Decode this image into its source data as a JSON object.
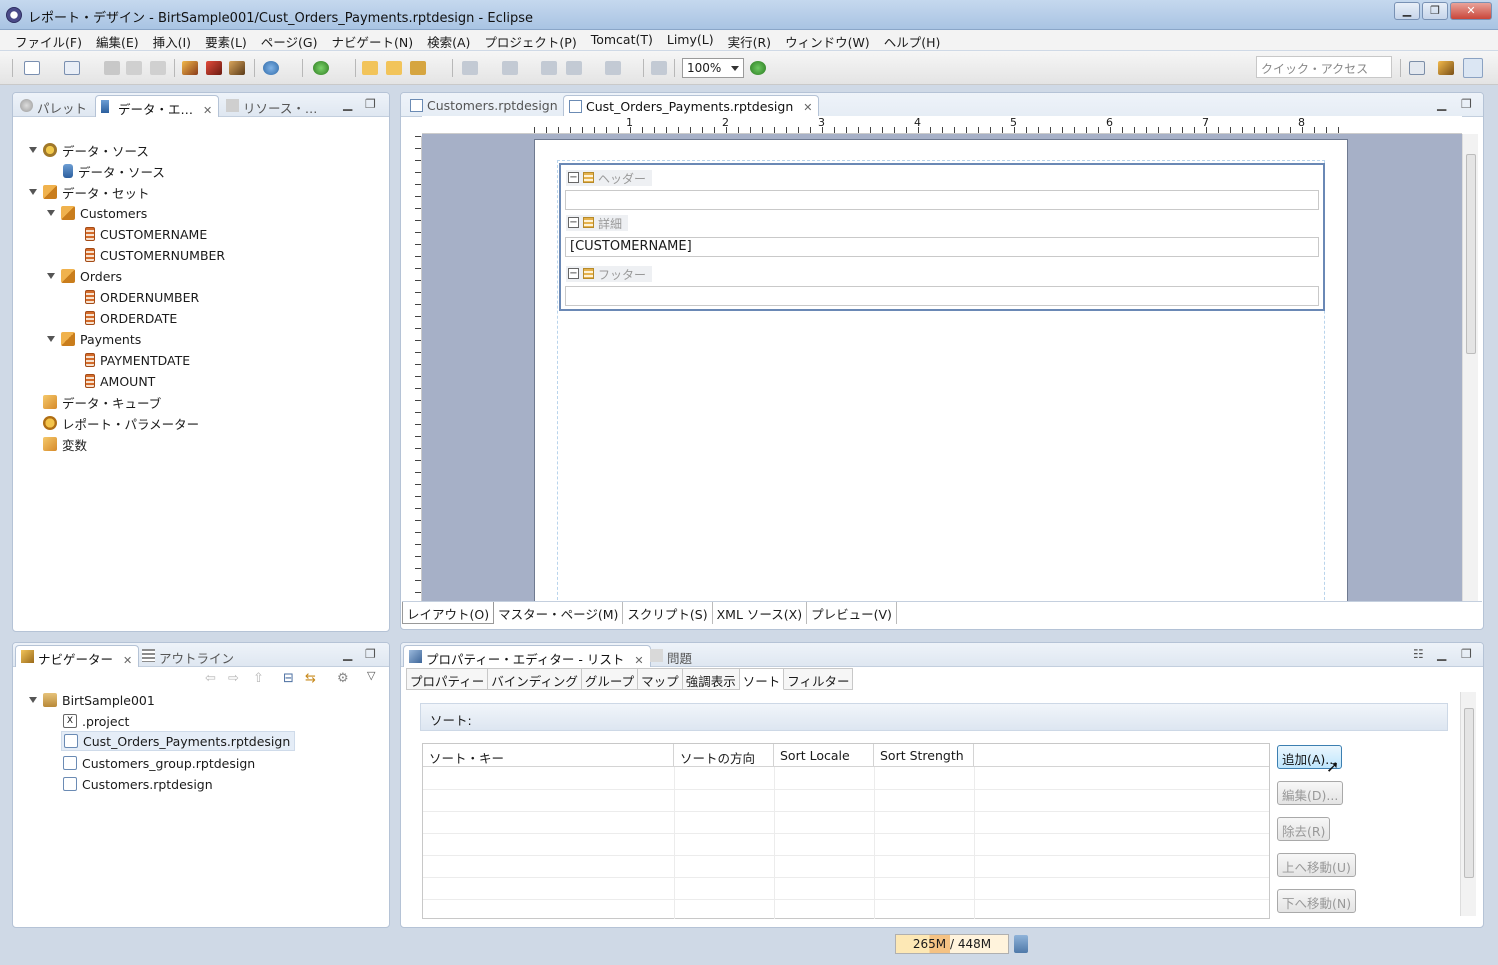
{
  "window": {
    "title": "レポート・デザイン - BirtSample001/Cust_Orders_Payments.rptdesign - Eclipse",
    "min": "▁",
    "max": "❐",
    "close": "✕"
  },
  "menu": [
    "ファイル(F)",
    "編集(E)",
    "挿入(I)",
    "要素(L)",
    "ページ(G)",
    "ナビゲート(N)",
    "検索(A)",
    "プロジェクト(P)",
    "Tomcat(T)",
    "Limy(L)",
    "実行(R)",
    "ウィンドウ(W)",
    "ヘルプ(H)"
  ],
  "toolbar": {
    "zoom": "100%",
    "quick_access_placeholder": "クイック・アクセス"
  },
  "left_top_panel": {
    "tabs": [
      "パレット",
      "データ・エ…",
      "リソース・…"
    ],
    "tree": {
      "data_sources": "データ・ソース",
      "data_source": "データ・ソース",
      "data_sets": "データ・セット",
      "customers": "Customers",
      "customername": "CUSTOMERNAME",
      "customernumber": "CUSTOMERNUMBER",
      "orders": "Orders",
      "ordernumber": "ORDERNUMBER",
      "orderdate": "ORDERDATE",
      "payments": "Payments",
      "paymentdate": "PAYMENTDATE",
      "amount": "AMOUNT",
      "cubes": "データ・キューブ",
      "params": "レポート・パラメーター",
      "variables": "変数"
    }
  },
  "editor": {
    "tabs": [
      "Customers.rptdesign",
      "Cust_Orders_Payments.rptdesign"
    ],
    "ruler_numbers": [
      "1",
      "2",
      "3",
      "4",
      "5",
      "6",
      "7",
      "8"
    ],
    "bands": {
      "header": "ヘッダー",
      "detail": "詳細",
      "footer": "フッター"
    },
    "detail_field": "[CUSTOMERNAME]",
    "bottom_tabs": [
      "レイアウト(O)",
      "マスター・ページ(M)",
      "スクリプト(S)",
      "XML ソース(X)",
      "プレビュー(V)"
    ]
  },
  "navigator": {
    "tabs": [
      "ナビゲーター",
      "アウトライン"
    ],
    "project": "BirtSample001",
    "files": [
      ".project",
      "Cust_Orders_Payments.rptdesign",
      "Customers_group.rptdesign",
      "Customers.rptdesign"
    ]
  },
  "property_editor": {
    "tabs": [
      "プロパティー・エディター - リスト",
      "問題"
    ],
    "prop_tabs": [
      "プロパティー",
      "バインディング",
      "グループ",
      "マップ",
      "強調表示",
      "ソート",
      "フィルター"
    ],
    "section_title": "ソート:",
    "columns": [
      "ソート・キー",
      "ソートの方向",
      "Sort Locale",
      "Sort Strength"
    ],
    "buttons": {
      "add": "追加(A)...",
      "edit": "編集(D)...",
      "remove": "除去(R)",
      "move_up": "上へ移動(U)",
      "move_down": "下へ移動(N)"
    }
  },
  "status": {
    "heap": "265M / 448M"
  }
}
